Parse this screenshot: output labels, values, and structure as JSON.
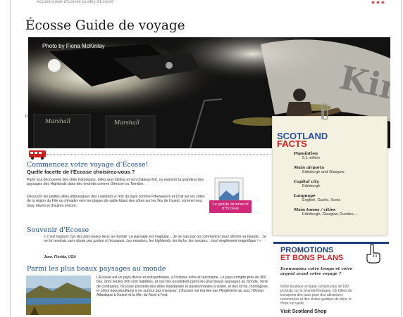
{
  "header": {
    "breadcrumb": "Accueil Guide d'Écosse Guides d'Écosse",
    "page_title": "Écosse Guide de voyage"
  },
  "hero": {
    "photo_credit": "Photo by Fiona McKinlay",
    "stage_sign": "King Tut's",
    "amp_label": "Marshall"
  },
  "facts": {
    "title_line1": "SCOTLAND",
    "title_line2": "FACTS",
    "items": [
      {
        "key": "Population",
        "value": "5,1 million"
      },
      {
        "key": "Main airports",
        "value": "Edinburgh and Glasgow"
      },
      {
        "key": "Capital city",
        "value": "Edinburgh"
      },
      {
        "key": "Language",
        "value": "English, Gaelic, Scots"
      },
      {
        "key": "Main towns / cities",
        "value": "Edinburgh, Glasgow, Dundee,..."
      }
    ]
  },
  "intro": {
    "title": "Commencez votre voyage d'Écosse!",
    "subtitle": "Quelle facette de l'Ecosse choisirez-vous ?",
    "para1": "Partir à la découverte des cités historiques, telles que Stirling et son château-fort, ou explorer la grandeur des paysages des Highlands dans des endroits comme Glencoe ou Torridon.",
    "para2": "Découvrir les petites villes pittoresques des Lowlands à l'est du pays comme Pittenweem et Crail sur les côtes de la région du Fife ou s'évader vers les plages de sable blanc des côtes sur les îles de l'ouest, comme Iona, Islay, Harris et d'autres encore.",
    "guide_button": "Le guide interactif d'Ecosse"
  },
  "souvenir": {
    "title": "Souvenir d'Écosse",
    "quote": "« C'est toujours l'un des plus beaux lieux au monde. Le paysage est magique... Je ne sais par où commencer pour décrire sa beauté... Je ne lui rendrais sans doute pas justice si j'essayais. Les moutons, les highlands, les lochs, les sorciers... tout simplement magnifique ! »",
    "author": "Jane, Florida, USA"
  },
  "paysages": {
    "title": "Parmi les plus beaux paysages au monde",
    "text": "L'Écosse est un pays divers et extraordinaire, à l'histoire riche et fascinante. Le pays compte près de 800 îles, dont seules 300 sont habitées, et ces îles possèdent parmi les plus beaux paysages au monde. Terre de contrastes, l'Écosse possède des villes trépidantes et passionnantes à visiter, et des lochs, montagnes et côtes époustouflants à ne surtout pas manquer. L'Écosse est bordée par l'Angleterre au sud, l'Océan Atlantique à l'ouest et la Mer du Nord à l'est."
  },
  "promotions": {
    "title_line1": "PROMOTIONS",
    "title_line2": "ET BONS PLANS",
    "subtitle": "Economisez votre temps et votre argent avant votre voyage ?",
    "text": "Notre boutique en ligne compte plus de 180 produits sur la Grande-Bretagne. De billets de transports des pass pour des attractions renommées et des visites guidées de sites, le choix est vaste.",
    "more": "Visit Scotland Shop"
  },
  "side_fragment": "D",
  "colors": {
    "title_blue": "#1d4f8c",
    "facts_red": "#c22222",
    "guide_pink": "#d1287a",
    "promo_navy": "#1d3f7a"
  }
}
